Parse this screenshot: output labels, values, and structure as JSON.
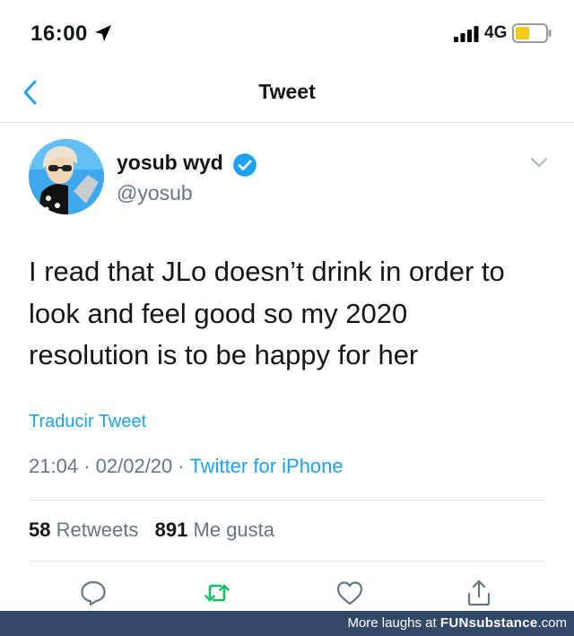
{
  "status_bar": {
    "time": "16:00",
    "network": "4G",
    "icons": [
      "location-arrow-icon",
      "signal-icon",
      "battery-icon"
    ],
    "battery_color": "#f7c815"
  },
  "nav": {
    "back_icon": "chevron-left-icon",
    "title": "Tweet"
  },
  "tweet": {
    "author": {
      "display_name": "yosub wyd",
      "handle": "@yosub",
      "verified": true
    },
    "text_lines": [
      "I read that JLo doesn’t drink in order to",
      "look and feel good so my 2020",
      "resolution is to be happy for her"
    ],
    "translate_label": "Traducir Tweet",
    "time": "21:04",
    "separator": "·",
    "date": "02/02/20",
    "source": "Twitter for iPhone",
    "stats": {
      "retweets_count": "58",
      "retweets_label": "Retweets",
      "likes_count": "891",
      "likes_label": "Me gusta"
    },
    "actions": [
      "reply-icon",
      "retweet-icon",
      "like-icon",
      "share-icon"
    ]
  },
  "footer": {
    "prefix": "More laughs at",
    "brand": "FUNsubstance",
    "suffix": ".com"
  },
  "colors": {
    "link_blue": "#1da1f2",
    "retweet_green": "#17bf63",
    "muted": "#657786",
    "footer_bg": "#33496a"
  }
}
